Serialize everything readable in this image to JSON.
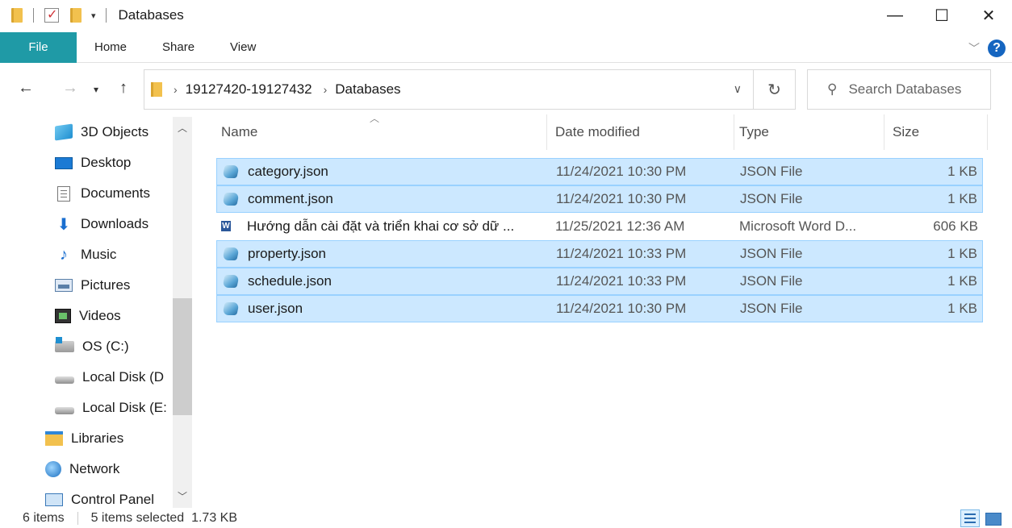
{
  "window": {
    "title": "Databases",
    "minimize": "—",
    "maximize": "☐",
    "close": "✕"
  },
  "ribbon": {
    "tabs": [
      "File",
      "Home",
      "Share",
      "View"
    ],
    "help": "?"
  },
  "address": {
    "crumbs": [
      "19127420-19127432",
      "Databases"
    ]
  },
  "search": {
    "placeholder": "Search Databases"
  },
  "nav_tree": [
    {
      "label": "3D Objects",
      "icon": "cube-icon"
    },
    {
      "label": "Desktop",
      "icon": "desktop-icon"
    },
    {
      "label": "Documents",
      "icon": "document-icon"
    },
    {
      "label": "Downloads",
      "icon": "download-arrow-icon"
    },
    {
      "label": "Music",
      "icon": "music-note-icon"
    },
    {
      "label": "Pictures",
      "icon": "pictures-icon"
    },
    {
      "label": "Videos",
      "icon": "video-icon"
    },
    {
      "label": "OS (C:)",
      "icon": "os-drive-icon"
    },
    {
      "label": "Local Disk (D",
      "icon": "disk-drive-icon"
    },
    {
      "label": "Local Disk (E:",
      "icon": "disk-drive-icon"
    },
    {
      "label": "Libraries",
      "icon": "libraries-icon"
    },
    {
      "label": "Network",
      "icon": "network-icon"
    },
    {
      "label": "Control Panel",
      "icon": "control-panel-icon"
    }
  ],
  "columns": {
    "name": "Name",
    "date": "Date modified",
    "type": "Type",
    "size": "Size"
  },
  "files": [
    {
      "name": "category.json",
      "date": "11/24/2021 10:30 PM",
      "type": "JSON File",
      "size": "1 KB",
      "selected": true,
      "icon": "json-file-icon"
    },
    {
      "name": "comment.json",
      "date": "11/24/2021 10:30 PM",
      "type": "JSON File",
      "size": "1 KB",
      "selected": true,
      "icon": "json-file-icon"
    },
    {
      "name": "Hướng dẫn cài đặt và triển khai cơ sở dữ ...",
      "date": "11/25/2021 12:36 AM",
      "type": "Microsoft Word D...",
      "size": "606 KB",
      "selected": false,
      "icon": "word-document-icon"
    },
    {
      "name": "property.json",
      "date": "11/24/2021 10:33 PM",
      "type": "JSON File",
      "size": "1 KB",
      "selected": true,
      "icon": "json-file-icon"
    },
    {
      "name": "schedule.json",
      "date": "11/24/2021 10:33 PM",
      "type": "JSON File",
      "size": "1 KB",
      "selected": true,
      "icon": "json-file-icon"
    },
    {
      "name": "user.json",
      "date": "11/24/2021 10:30 PM",
      "type": "JSON File",
      "size": "1 KB",
      "selected": true,
      "icon": "json-file-icon"
    }
  ],
  "status": {
    "count": "6 items",
    "selection": "5 items selected  1.73 KB"
  },
  "colors": {
    "file_tab": "#1f9aa6",
    "selection_bg": "#cce8ff",
    "selection_border": "#99d1ff"
  }
}
